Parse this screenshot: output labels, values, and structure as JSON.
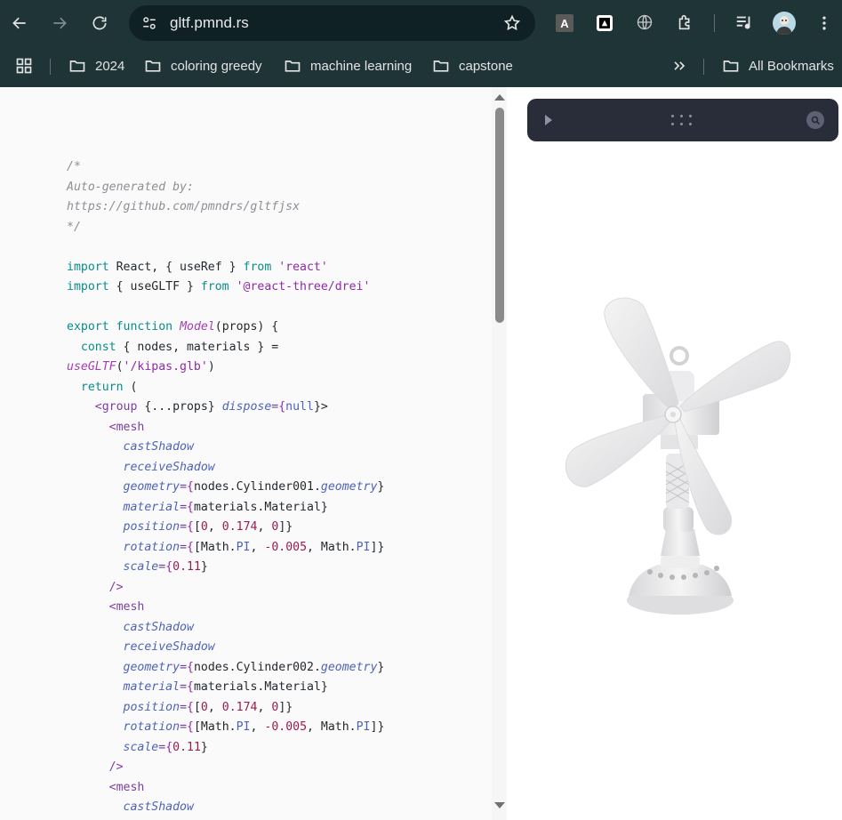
{
  "browser": {
    "url": "gltf.pmnd.rs",
    "extension_a_label": "A",
    "bookmarks": [
      {
        "label": "2024"
      },
      {
        "label": "coloring greedy"
      },
      {
        "label": "machine learning"
      },
      {
        "label": "capstone"
      }
    ],
    "all_bookmarks_label": "All Bookmarks",
    "colors": {
      "chrome_bg": "#1f3437",
      "omnibox_bg": "#0f2124"
    }
  },
  "code": {
    "lines": [
      "/*",
      "Auto-generated by:",
      "https://github.com/pmndrs/gltfjsx",
      "*/",
      "",
      "import React, { useRef } from 'react'",
      "import { useGLTF } from '@react-three/drei'",
      "",
      "export function Model(props) {",
      "  const { nodes, materials } =",
      "useGLTF('/kipas.glb')",
      "  return (",
      "    <group {...props} dispose={null}>",
      "      <mesh",
      "        castShadow",
      "        receiveShadow",
      "        geometry={nodes.Cylinder001.geometry}",
      "        material={materials.Material}",
      "        position={[0, 0.174, 0]}",
      "        rotation={[Math.PI, -0.005, Math.PI]}",
      "        scale={0.11}",
      "      />",
      "      <mesh",
      "        castShadow",
      "        receiveShadow",
      "        geometry={nodes.Cylinder002.geometry}",
      "        material={materials.Material}",
      "        position={[0, 0.174, 0]}",
      "        rotation={[Math.PI, -0.005, Math.PI]}",
      "        scale={0.11}",
      "      />",
      "      <mesh",
      "        castShadow"
    ]
  },
  "viewer": {
    "panel_color": "#292d39",
    "icons": [
      "play-icon",
      "drag-grip-icon",
      "search-icon"
    ]
  }
}
